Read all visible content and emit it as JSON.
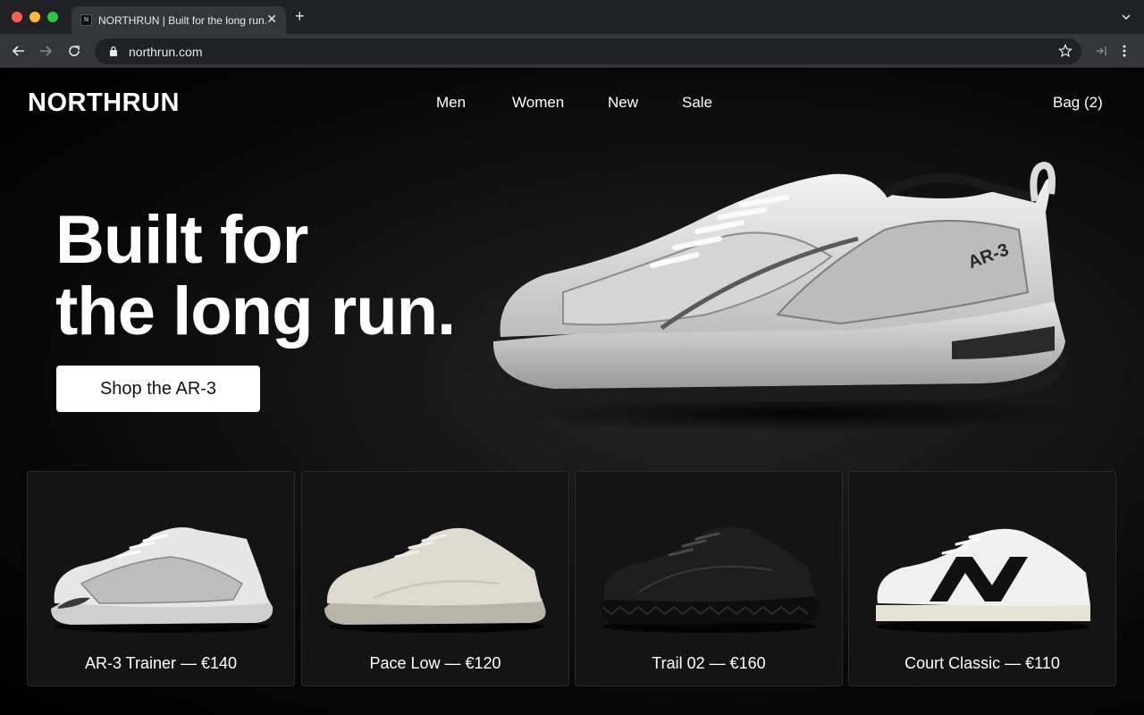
{
  "browser": {
    "tab_title": "NORTHRUN | Built for the long run.",
    "favicon_letter": "N",
    "url": "northrun.com"
  },
  "site": {
    "logo": "NORTHRUN",
    "nav": [
      "Men",
      "Women",
      "New",
      "Sale"
    ],
    "bag": "Bag (2)"
  },
  "hero": {
    "title_line1": "Built for",
    "title_line2": "the long run.",
    "cta": "Shop the AR-3",
    "shoe_model_text": "AR-3"
  },
  "products": [
    {
      "label": "AR-3 Trainer — €140",
      "name": "AR-3 Trainer",
      "price": "€140"
    },
    {
      "label": "Pace Low — €120",
      "name": "Pace Low",
      "price": "€120"
    },
    {
      "label": "Trail 02 — €160",
      "name": "Trail 02",
      "price": "€160"
    },
    {
      "label": "Court Classic — €110",
      "name": "Court Classic",
      "price": "€110"
    }
  ],
  "colors": {
    "page_bg": "#000000",
    "card_bg": "#141414",
    "cta_bg": "#ffffff",
    "text": "#ffffff"
  }
}
